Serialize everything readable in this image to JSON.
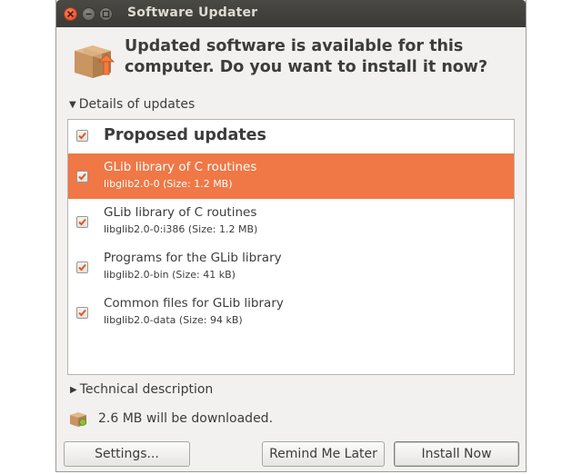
{
  "window": {
    "title": "Software Updater"
  },
  "header": {
    "message": "Updated software is available for this computer. Do you want to install it now?"
  },
  "details_expander": {
    "label": "Details of updates",
    "expanded": true
  },
  "updates": {
    "group": {
      "label": "Proposed updates",
      "checked": true
    },
    "items": [
      {
        "title": "GLib library of C routines",
        "subtitle": "libglib2.0-0 (Size: 1.2 MB)",
        "checked": true,
        "selected": true
      },
      {
        "title": "GLib library of C routines",
        "subtitle": "libglib2.0-0:i386 (Size: 1.2 MB)",
        "checked": true,
        "selected": false
      },
      {
        "title": "Programs for the GLib library",
        "subtitle": "libglib2.0-bin (Size: 41 kB)",
        "checked": true,
        "selected": false
      },
      {
        "title": "Common files for GLib library",
        "subtitle": "libglib2.0-data (Size: 94 kB)",
        "checked": true,
        "selected": false
      }
    ]
  },
  "technical_expander": {
    "label": "Technical description",
    "expanded": false
  },
  "download": {
    "text": "2.6 MB will be downloaded."
  },
  "buttons": {
    "settings": "Settings...",
    "remind": "Remind Me Later",
    "install": "Install Now"
  },
  "colors": {
    "accent": "#f07746",
    "checkmark": "#e05a20",
    "titlebar": "#3c3b37"
  },
  "icons": {
    "package": "package-upgrade-icon",
    "download": "download-package-icon"
  }
}
